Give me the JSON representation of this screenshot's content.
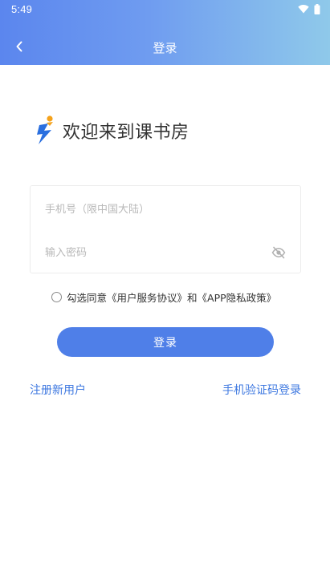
{
  "status_bar": {
    "time": "5:49"
  },
  "nav": {
    "title": "登录"
  },
  "welcome": {
    "text": "欢迎来到课书房"
  },
  "form": {
    "phone_placeholder": "手机号（限中国大陆）",
    "password_placeholder": "输入密码"
  },
  "agreement": {
    "prefix": "勾选同意",
    "user_agreement": "《用户服务协议》",
    "conjunction": "和",
    "privacy_policy": "《APP隐私政策》"
  },
  "actions": {
    "login_label": "登录",
    "register_label": "注册新用户",
    "sms_login_label": "手机验证码登录"
  },
  "colors": {
    "header_start": "#5b86ee",
    "header_end": "#8fc9ea",
    "primary": "#4f7fe8",
    "link": "#3e78e0",
    "logo_blue": "#2a6fdf",
    "logo_orange": "#f5a21b"
  }
}
